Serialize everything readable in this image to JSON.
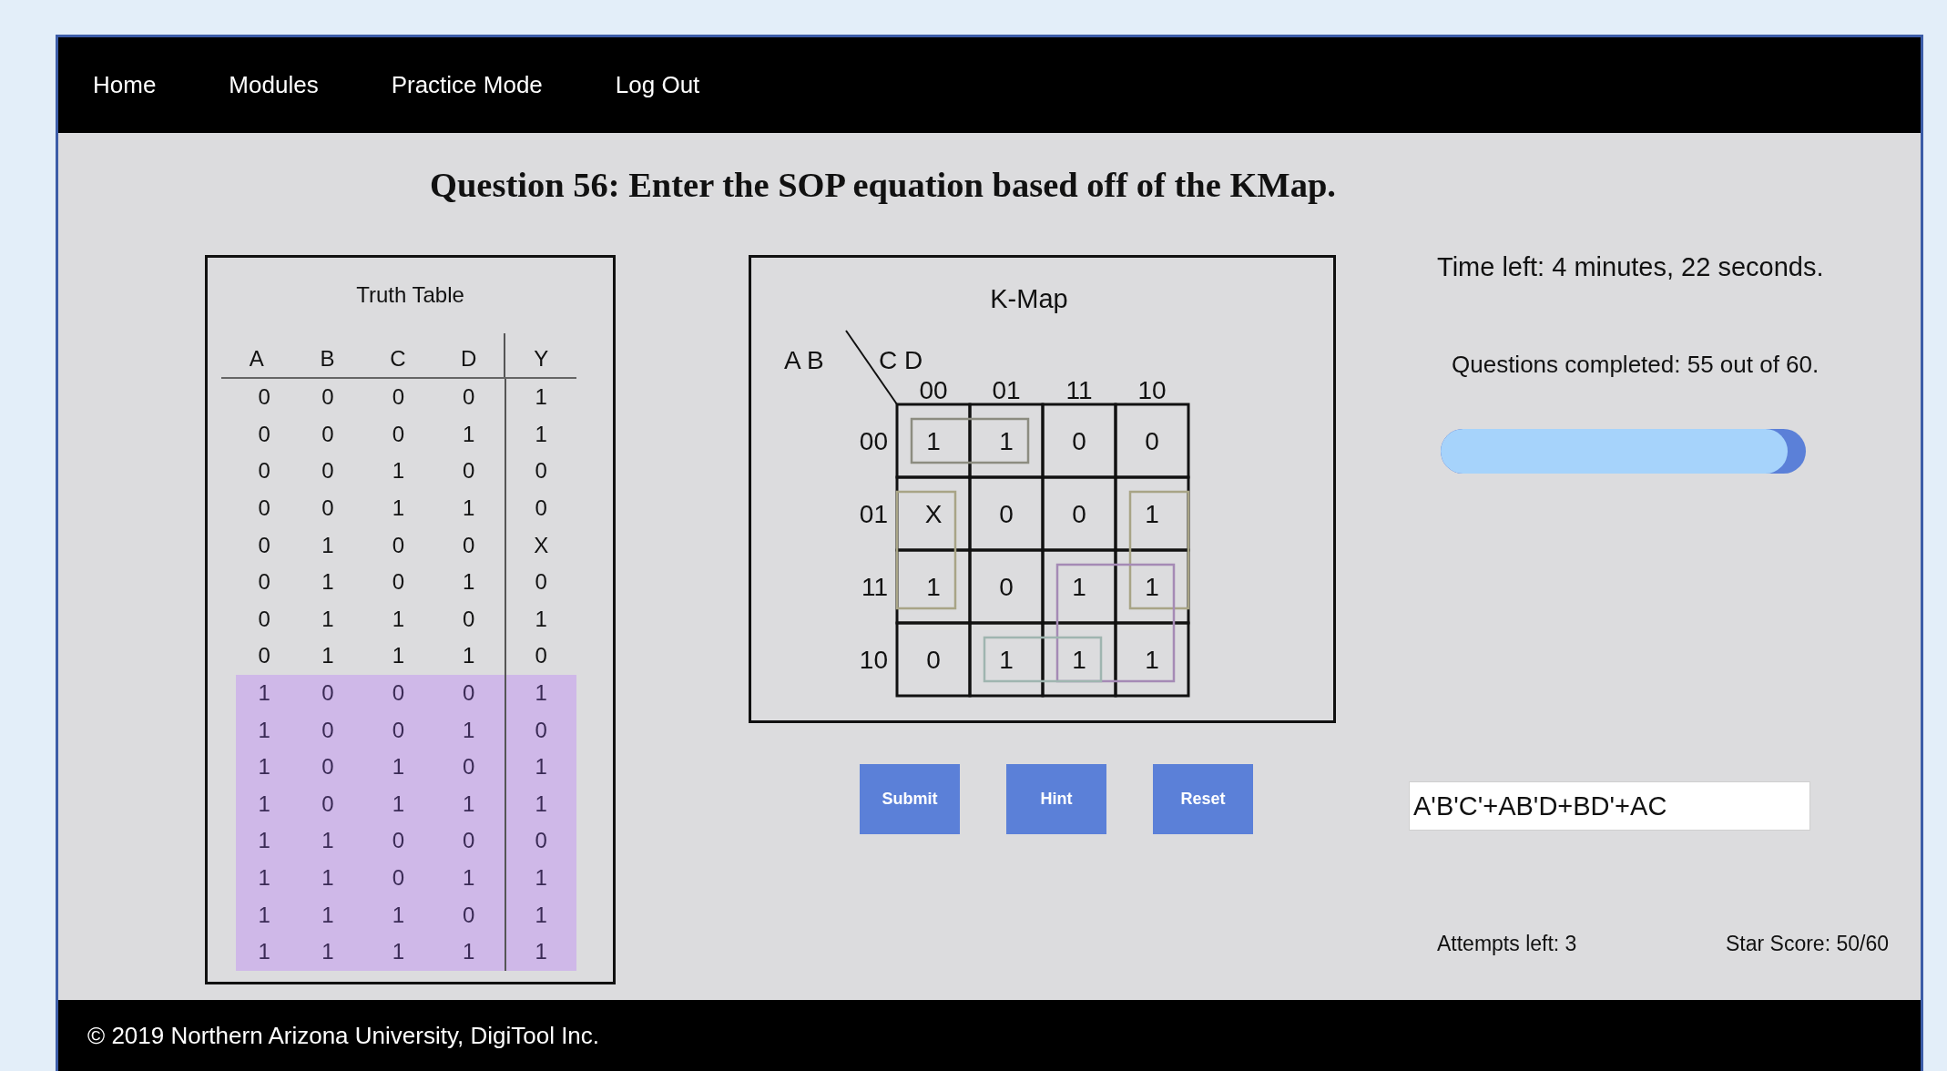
{
  "nav": [
    "Home",
    "Modules",
    "Practice Mode",
    "Log Out"
  ],
  "question": "Question 56: Enter the SOP equation based off of the KMap.",
  "truth_table": {
    "title": "Truth Table",
    "columns": [
      "A",
      "B",
      "C",
      "D",
      "Y"
    ],
    "rows": [
      {
        "cells": [
          "0",
          "0",
          "0",
          "0",
          "1"
        ],
        "highlighted": false
      },
      {
        "cells": [
          "0",
          "0",
          "0",
          "1",
          "1"
        ],
        "highlighted": false
      },
      {
        "cells": [
          "0",
          "0",
          "1",
          "0",
          "0"
        ],
        "highlighted": false
      },
      {
        "cells": [
          "0",
          "0",
          "1",
          "1",
          "0"
        ],
        "highlighted": false
      },
      {
        "cells": [
          "0",
          "1",
          "0",
          "0",
          "X"
        ],
        "highlighted": false
      },
      {
        "cells": [
          "0",
          "1",
          "0",
          "1",
          "0"
        ],
        "highlighted": false
      },
      {
        "cells": [
          "0",
          "1",
          "1",
          "0",
          "1"
        ],
        "highlighted": false
      },
      {
        "cells": [
          "0",
          "1",
          "1",
          "1",
          "0"
        ],
        "highlighted": false
      },
      {
        "cells": [
          "1",
          "0",
          "0",
          "0",
          "1"
        ],
        "highlighted": true
      },
      {
        "cells": [
          "1",
          "0",
          "0",
          "1",
          "0"
        ],
        "highlighted": true
      },
      {
        "cells": [
          "1",
          "0",
          "1",
          "0",
          "1"
        ],
        "highlighted": true
      },
      {
        "cells": [
          "1",
          "0",
          "1",
          "1",
          "1"
        ],
        "highlighted": true
      },
      {
        "cells": [
          "1",
          "1",
          "0",
          "0",
          "0"
        ],
        "highlighted": true
      },
      {
        "cells": [
          "1",
          "1",
          "0",
          "1",
          "1"
        ],
        "highlighted": true
      },
      {
        "cells": [
          "1",
          "1",
          "1",
          "0",
          "1"
        ],
        "highlighted": true
      },
      {
        "cells": [
          "1",
          "1",
          "1",
          "1",
          "1"
        ],
        "highlighted": true
      }
    ]
  },
  "kmap": {
    "title": "K-Map",
    "row_vars": "A B",
    "col_vars": "C D",
    "col_labels": [
      "00",
      "01",
      "11",
      "10"
    ],
    "row_labels": [
      "00",
      "01",
      "11",
      "10"
    ],
    "cells": [
      [
        "1",
        "1",
        "0",
        "0"
      ],
      [
        "X",
        "0",
        "0",
        "1"
      ],
      [
        "1",
        "0",
        "1",
        "1"
      ],
      [
        "0",
        "1",
        "1",
        "1"
      ]
    ],
    "groups": [
      {
        "color": "#8c8c80"
      },
      {
        "color": "#a8a486"
      },
      {
        "color": "#a58ab5"
      },
      {
        "color": "#9fb5b0"
      }
    ]
  },
  "buttons": [
    "Submit",
    "Hint",
    "Reset"
  ],
  "time_left": "Time left: 4 minutes, 22 seconds.",
  "questions_completed": "Questions completed: 55 out of 60.",
  "progress": {
    "level": 0.95
  },
  "answer": {
    "value": "A'B'C'+AB'D+BD'+AC"
  },
  "attempts": "Attempts left: 3",
  "star_score": "Star Score: 50/60",
  "footer": "© 2019 Northern Arizona University, DigiTool Inc."
}
